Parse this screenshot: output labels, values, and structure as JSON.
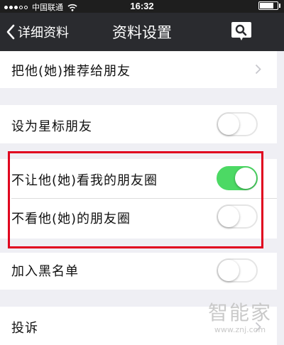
{
  "status_bar": {
    "carrier": "中国联通",
    "time": "16:32",
    "battery_level": 0.85
  },
  "navbar": {
    "back_label": "详细资料",
    "title": "资料设置",
    "action_icon": "search-icon"
  },
  "rows": {
    "recommend": {
      "label": "把他(她)推荐给朋友"
    },
    "star": {
      "label": "设为星标朋友",
      "on": false
    },
    "hide_my_moments": {
      "label": "不让他(她)看我的朋友圈",
      "on": true
    },
    "hide_their_moments": {
      "label": "不看他(她)的朋友圈",
      "on": false
    },
    "blacklist": {
      "label": "加入黑名单",
      "on": false
    },
    "report": {
      "label": "投诉"
    }
  },
  "colors": {
    "navbar": "#2a2b2f",
    "toggle_on": "#4cd964",
    "highlight": "#e0001e",
    "background": "#efeff4"
  },
  "watermark": {
    "brand": "智能家",
    "url": "www.znj.com"
  }
}
